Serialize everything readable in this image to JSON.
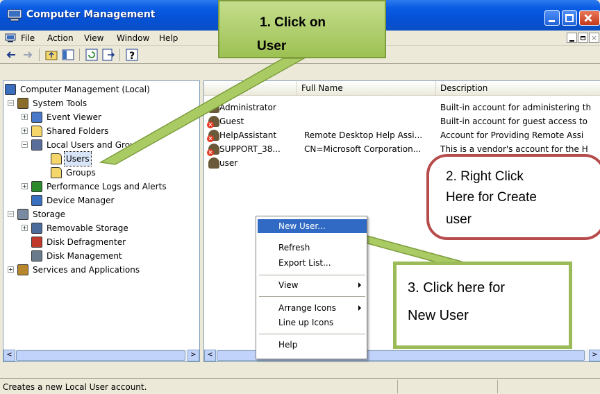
{
  "window": {
    "title": "Computer Management"
  },
  "menubar": {
    "items": [
      "File",
      "Action",
      "View",
      "Window",
      "Help"
    ]
  },
  "tree": [
    {
      "label": "Computer Management (Local)",
      "icon": "computer-icon",
      "level": 0
    },
    {
      "label": "System Tools",
      "icon": "tools-icon",
      "level": 1,
      "expander": "−"
    },
    {
      "label": "Event Viewer",
      "icon": "event-viewer-icon",
      "level": 2,
      "expander": "+"
    },
    {
      "label": "Shared Folders",
      "icon": "folder-icon",
      "level": 2,
      "expander": "+"
    },
    {
      "label": "Local Users and Groups",
      "icon": "users-groups-icon",
      "level": 2,
      "expander": "−"
    },
    {
      "label": "Users",
      "icon": "folder-icon",
      "level": 3,
      "selected": true
    },
    {
      "label": "Groups",
      "icon": "folder-icon",
      "level": 3
    },
    {
      "label": "Performance Logs and Alerts",
      "icon": "performance-icon",
      "level": 2,
      "expander": "+"
    },
    {
      "label": "Device Manager",
      "icon": "device-manager-icon",
      "level": 2
    },
    {
      "label": "Storage",
      "icon": "storage-icon",
      "level": 1,
      "expander": "−"
    },
    {
      "label": "Removable Storage",
      "icon": "removable-storage-icon",
      "level": 2,
      "expander": "+"
    },
    {
      "label": "Disk Defragmenter",
      "icon": "defrag-icon",
      "level": 2
    },
    {
      "label": "Disk Management",
      "icon": "disk-management-icon",
      "level": 2
    },
    {
      "label": "Services and Applications",
      "icon": "services-icon",
      "level": 1,
      "expander": "+"
    }
  ],
  "list": {
    "columns": [
      "",
      "Full Name",
      "Description"
    ],
    "rows": [
      {
        "name": "Administrator",
        "full_name": "",
        "description": "Built-in account for administering th",
        "disabled": false
      },
      {
        "name": "Guest",
        "full_name": "",
        "description": "Built-in account for guest access to",
        "disabled": true
      },
      {
        "name": "HelpAssistant",
        "full_name": "Remote Desktop Help Assi...",
        "description": "Account for Providing Remote Assi",
        "disabled": true
      },
      {
        "name": "SUPPORT_38...",
        "full_name": "CN=Microsoft Corporation...",
        "description": "This is a vendor's account for the H",
        "disabled": true
      },
      {
        "name": "user",
        "full_name": "",
        "description": "",
        "disabled": false
      }
    ]
  },
  "context_menu": {
    "items": [
      {
        "label": "New User...",
        "selected": true
      },
      {
        "label": "Refresh"
      },
      {
        "label": "Export List..."
      },
      {
        "label": "View",
        "submenu": true
      },
      {
        "label": "Arrange Icons",
        "submenu": true
      },
      {
        "label": "Line up Icons"
      },
      {
        "label": "Help"
      }
    ]
  },
  "callouts": {
    "c1_line1": "1.  Click on",
    "c1_line2": "User",
    "c2_line1": "2.  Right Click",
    "c2_line2": "Here for Create",
    "c2_line3": "user",
    "c3_line1": "3.  Click here for",
    "c3_line2": "New User"
  },
  "statusbar": {
    "text": "Creates a new Local User account."
  },
  "colors": {
    "titlebar": "#0a5de4",
    "selection": "#316ac5",
    "callout1": "#9dc153",
    "callout2_border": "#b64c4c",
    "callout3_border": "#9bbb59"
  }
}
